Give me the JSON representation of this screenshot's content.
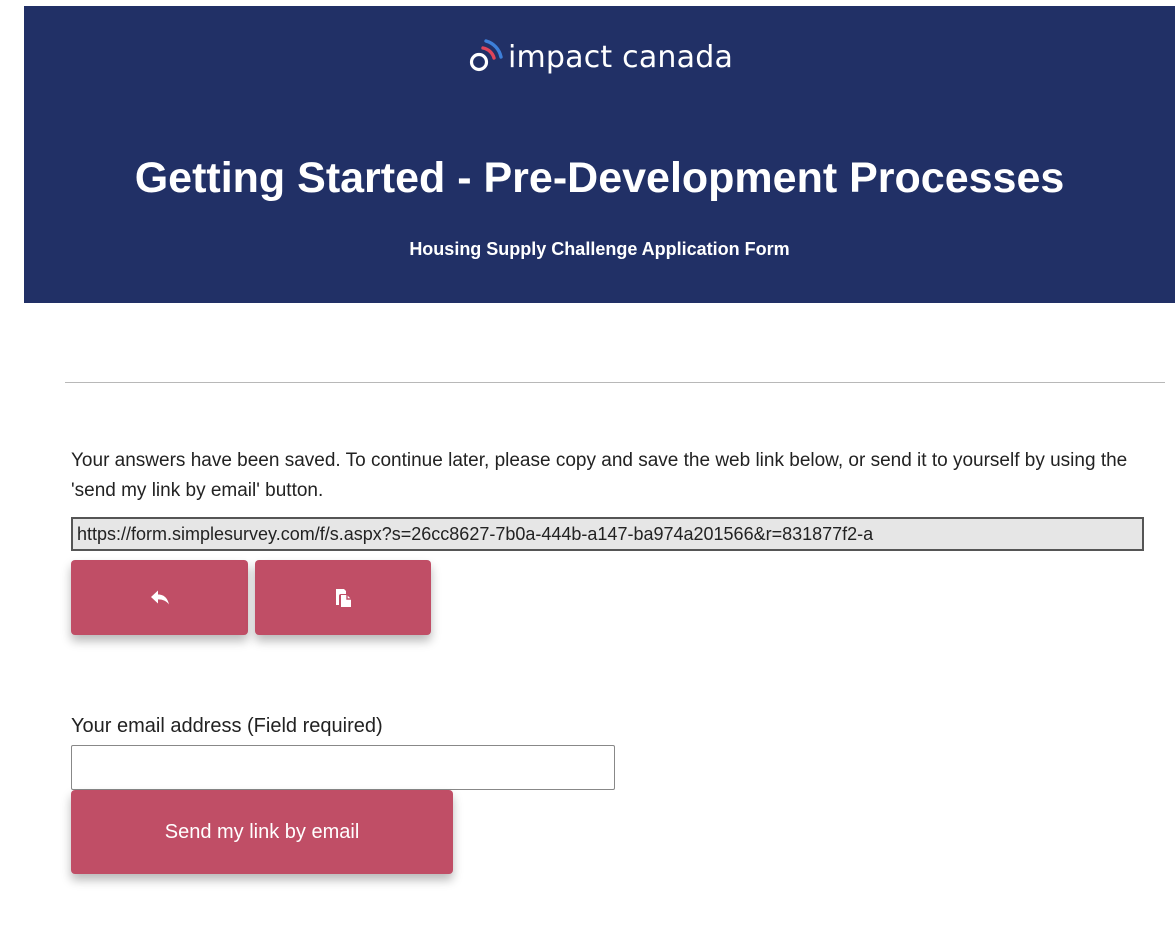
{
  "header": {
    "logo_text": "impact canada",
    "title": "Getting Started - Pre-Development Processes",
    "subtitle": "Housing Supply Challenge Application Form",
    "background_color": "#213066",
    "logo_arc_colors": [
      "#e0455a",
      "#3d7fd9"
    ]
  },
  "save_notice": {
    "message": "Your answers have been saved. To continue later, please copy and save the web link below, or send it to yourself by using the 'send my link by email' button.",
    "link": "https://form.simplesurvey.com/f/s.aspx?s=26cc8627-7b0a-444b-a147-ba974a201566&r=831877f2-a"
  },
  "actions": {
    "back_icon": "reply-arrow-icon",
    "copy_icon": "copy-clipboard-icon",
    "button_color": "#c04e66"
  },
  "email_form": {
    "label": "Your email address (Field required)",
    "value": "",
    "send_label": "Send my link by email"
  }
}
